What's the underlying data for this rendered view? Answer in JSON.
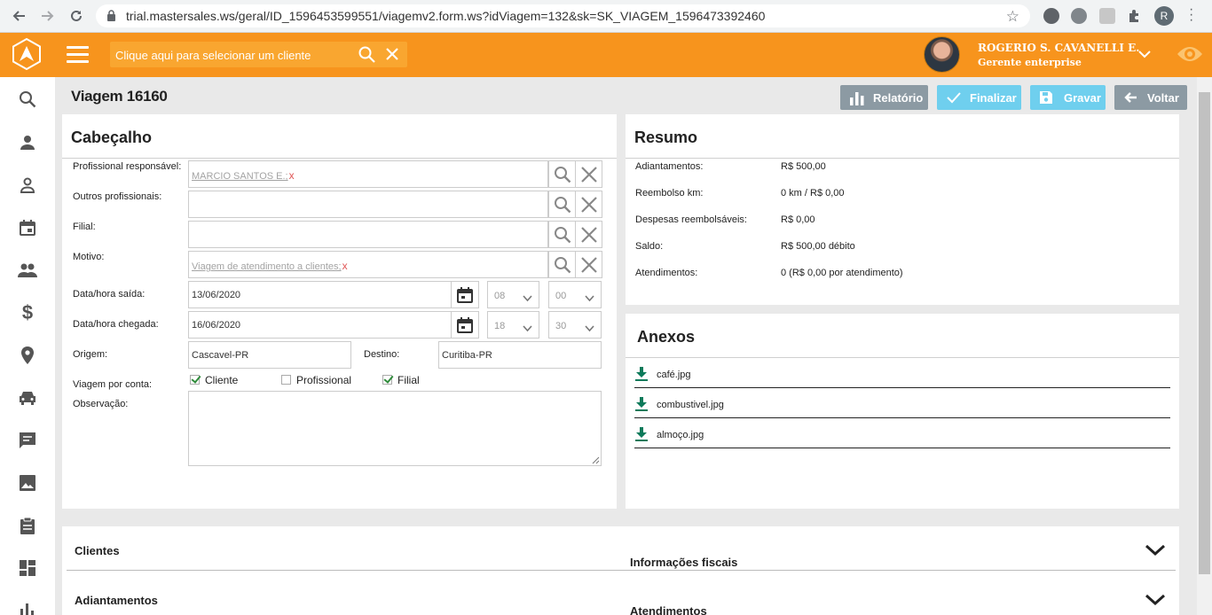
{
  "browser": {
    "url": "trial.mastersales.ws/geral/ID_1596453599551/viagemv2.form.ws?idViagem=132&sk=SK_VIAGEM_1596473392460",
    "profile_initial": "R"
  },
  "header": {
    "client_search_placeholder": "Clique aqui para selecionar um cliente",
    "user_name": "ROGERIO S. CAVANELLI E.",
    "user_role": "Gerente enterprise"
  },
  "colors": {
    "brand_orange": "#f7941d",
    "button_gray": "#8c9aa3",
    "button_blue": "#6fcfee"
  },
  "sidebar": {
    "items": [
      "search-icon",
      "person-icon",
      "person-outline-icon",
      "calendar-icon",
      "group-icon",
      "dollar-icon",
      "location-icon",
      "car-icon",
      "chat-icon",
      "image-icon",
      "clipboard-icon",
      "dashboard-icon",
      "bar-chart-icon"
    ]
  },
  "page": {
    "title": "Viagem 16160",
    "buttons": {
      "relatorio": "Relatório",
      "finalizar": "Finalizar",
      "gravar": "Gravar",
      "voltar": "Voltar"
    }
  },
  "cabecalho": {
    "title": "Cabeçalho",
    "profissional_label": "Profissional responsável:",
    "profissional_value": "MARCIO SANTOS E.;",
    "outros_label": "Outros profissionais:",
    "filial_label": "Filial:",
    "motivo_label": "Motivo:",
    "motivo_value": "Viagem de atendimento a clientes;",
    "remove_mark": "x",
    "saida_label": "Data/hora saída:",
    "saida_date": "13/06/2020",
    "saida_hour": "08",
    "saida_min": "00",
    "chegada_label": "Data/hora chegada:",
    "chegada_date": "16/06/2020",
    "chegada_hour": "18",
    "chegada_min": "30",
    "origem_label": "Origem:",
    "origem_value": "Cascavel-PR",
    "destino_label": "Destino:",
    "destino_value": "Curitiba-PR",
    "conta_label": "Viagem por conta:",
    "conta_options": [
      {
        "label": "Cliente",
        "checked": true
      },
      {
        "label": "Profissional",
        "checked": false
      },
      {
        "label": "Filial",
        "checked": true
      }
    ],
    "observacao_label": "Observação:"
  },
  "resumo": {
    "title": "Resumo",
    "rows": [
      {
        "label": "Adiantamentos:",
        "value": "R$ 500,00"
      },
      {
        "label": "Reembolso km:",
        "value": "0 km / R$ 0,00"
      },
      {
        "label": "Despesas reembolsáveis:",
        "value": "R$ 0,00"
      },
      {
        "label": "Saldo:",
        "value": "R$ 500,00 débito"
      },
      {
        "label": "Atendimentos:",
        "value": "0 (R$ 0,00 por atendimento)"
      }
    ]
  },
  "anexos": {
    "title": "Anexos",
    "files": [
      "café.jpg",
      "combustivel.jpg",
      "almoço.jpg"
    ]
  },
  "accordions": {
    "clientes": "Clientes",
    "info_fiscais": "Informações fiscais",
    "adiantamentos": "Adiantamentos",
    "atendimentos": "Atendimentos"
  }
}
